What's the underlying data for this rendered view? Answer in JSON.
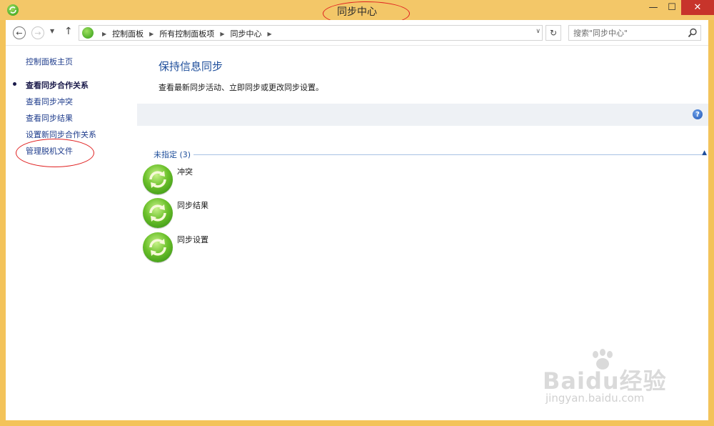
{
  "window": {
    "title": "同步中心",
    "minimize_glyph": "—",
    "maximize_glyph": "☐",
    "close_glyph": "✕",
    "icon": "sync-center-icon"
  },
  "nav": {
    "back_glyph": "←",
    "forward_glyph": "→",
    "history_glyph": "▼",
    "up_glyph": "↑",
    "breadcrumb": [
      "控制面板",
      "所有控制面板项",
      "同步中心"
    ],
    "separator_glyph": "▶",
    "dropdown_glyph": "∨",
    "refresh_glyph": "↻",
    "search_placeholder": "搜索\"同步中心\""
  },
  "sidebar": {
    "home": "控制面板主页",
    "items": [
      "查看同步合作关系",
      "查看同步冲突",
      "查看同步结果",
      "设置新同步合作关系",
      "管理脱机文件"
    ],
    "current_index": 0
  },
  "main": {
    "title": "保持信息同步",
    "description": "查看最新同步活动、立即同步或更改同步设置。",
    "help_glyph": "?",
    "group_label": "未指定 (3)",
    "collapse_glyph": "▲",
    "items": [
      {
        "label": "冲突",
        "icon": "sync-icon"
      },
      {
        "label": "同步结果",
        "icon": "sync-icon"
      },
      {
        "label": "同步设置",
        "icon": "sync-icon"
      }
    ]
  },
  "watermark": {
    "brand": "Baidu经验",
    "url": "jingyan.baidu.com"
  },
  "colors": {
    "frame": "#f3c768",
    "close": "#c7342b",
    "link": "#1e3c8c",
    "heading": "#1e4e9b",
    "annotation": "#e02020"
  }
}
